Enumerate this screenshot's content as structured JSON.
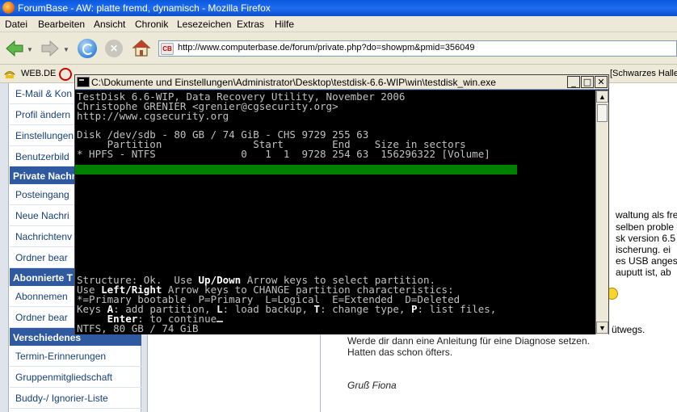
{
  "browser": {
    "title": "ForumBase - AW: platte fremd, dynamisch - Mozilla Firefox",
    "menu": [
      "Datei",
      "Bearbeiten",
      "Ansicht",
      "Chronik",
      "Lesezeichen",
      "Extras",
      "Hilfe"
    ],
    "url": "http://www.computerbase.de/forum/private.php?do=showpm&pmid=356049",
    "favicon_text": "CB",
    "bookmarks": [
      "WEB.DE",
      "[Schwarzes Halle"
    ]
  },
  "sidebar": {
    "items_top": [
      "E-Mail & Kon",
      "Profil ändern",
      "Einstellungen",
      "Benutzerbild"
    ],
    "section_private": "Private Nachri",
    "items_private": [
      "Posteingang",
      "Neue Nachri",
      "Nachrichtenv",
      "Ordner bear"
    ],
    "section_subscribed": "Abonnierte T",
    "items_subscribed": [
      "Abonnemen",
      "Ordner bear"
    ],
    "section_misc": "Verschiedenes",
    "items_misc": [
      "Termin-Erinnerungen",
      "Gruppenmitgliedschaft",
      "Buddy-/ Ignorier-Liste"
    ]
  },
  "message": {
    "snippets": [
      "waltung als fre",
      "selben proble",
      "sk version 6.5",
      "ischerung. ei",
      "es USB anges",
      "auputt ist, ab"
    ],
    "tail_snippet": "ütwegs.",
    "line1": "Werde dir dann eine Anleitung für eine Diagnose setzen.",
    "line2": "Hatten das schon öfters.",
    "signature": "Gruß Fiona"
  },
  "console": {
    "title": "C:\\Dokumente und Einstellungen\\Administrator\\Desktop\\testdisk-6.6-WIP\\win\\testdisk_win.exe",
    "header1": "TestDisk 6.6-WIP, Data Recovery Utility, November 2006",
    "header2": "Christophe GRENIER <grenier@cgsecurity.org>",
    "header3": "http://www.cgsecurity.org",
    "disk": "Disk /dev/sdb - 80 GB / 74 GiB - CHS 9729 255 63",
    "table_header": "     Partition               Start        End    Size in sectors",
    "partition_row": "* HPFS - NTFS              0   1  1  9728 254 63  156296322 [Volume]",
    "structure_pre": "Structure: Ok.  Use ",
    "structure_key": "Up/Down",
    "structure_post": " Arrow keys to select partition.",
    "use_pre": "Use ",
    "use_key": "Left/Right",
    "use_post": " Arrow keys to CHANGE partition characteristics:",
    "legend": "*=Primary bootable  P=Primary  L=Logical  E=Extended  D=Deleted",
    "keys_pre": "Keys ",
    "keys_A": "A",
    "keys_mid1": ": add partition, ",
    "keys_L": "L",
    "keys_mid2": ": load backup, ",
    "keys_T": "T",
    "keys_mid3": ": change type, ",
    "keys_P": "P",
    "keys_post": ": list files,",
    "enter_indent": "     ",
    "enter_key": "Enter",
    "enter_post": ": to continue",
    "status": "NTFS, 80 GB / 74 GiB"
  },
  "colors": {
    "console_bg": "#000000",
    "console_text": "#c0c0c0",
    "selection": "#008000",
    "sidebar_header": "#2f5aa0",
    "sidebar_link": "#16407a"
  }
}
